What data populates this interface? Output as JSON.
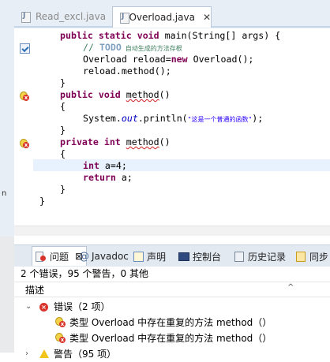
{
  "editor": {
    "tabs": [
      {
        "label": "Read_excl.java",
        "active": false
      },
      {
        "label": "Overload.java",
        "active": true
      }
    ],
    "close_glyph": "✕",
    "lines": {
      "l1": {
        "a": "public static void ",
        "b": "main(String[] args) {"
      },
      "l2": {
        "a": "// ",
        "b": "TODO",
        "c": " 自动生成的方法存根"
      },
      "l3": {
        "a": "Overload reload=",
        "b": "new",
        "c": " Overload();"
      },
      "l4": "reload.method();",
      "l5": "}",
      "l6": {
        "a": "public void ",
        "b": "method",
        "c": "()"
      },
      "l7": "{",
      "l8": {
        "a": "System.",
        "b": "out",
        "c": ".println(",
        "d": "\"这是一个普通的函数\"",
        "e": ");"
      },
      "l9": "}",
      "l10": {
        "a": "private int ",
        "b": "method",
        "c": "()"
      },
      "l11": "{",
      "l12": {
        "a": "int",
        "b": " a=4;"
      },
      "l13": {
        "a": "return",
        "b": " a;"
      },
      "l14": "}",
      "l15": "}"
    },
    "left_strip_char": "n"
  },
  "problems_view": {
    "tabs": [
      {
        "label": "问题",
        "icon": "problems-icon"
      },
      {
        "label": "Javadoc",
        "icon": "at-icon"
      },
      {
        "label": "声明",
        "icon": "declaration-icon"
      },
      {
        "label": "控制台",
        "icon": "console-icon"
      },
      {
        "label": "历史记录",
        "icon": "history-icon"
      },
      {
        "label": "同步",
        "icon": "sync-icon"
      }
    ],
    "summary": "2 个错误，95 个警告，0 其他",
    "column_header": "描述",
    "sort_glyph": "^",
    "groups": [
      {
        "label": "错误（2 项）",
        "expanded": true,
        "items": [
          "类型 Overload 中存在重复的方法 method（）",
          "类型 Overload 中存在重复的方法 method（）"
        ]
      },
      {
        "label": "警告（95 项）",
        "expanded": false
      }
    ]
  },
  "colors": {
    "keyword": "#7f0055",
    "comment": "#3f7f5f",
    "string": "#2a00ff",
    "field": "#0000c0",
    "error": "#d9342b",
    "current_line": "#e8f2fe"
  }
}
